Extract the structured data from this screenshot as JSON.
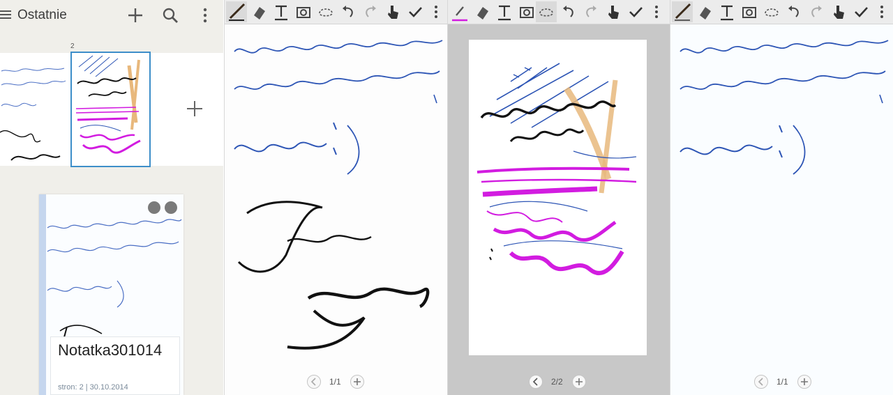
{
  "library": {
    "title": "Ostatnie",
    "thumb_page_number": "2",
    "note": {
      "name": "Notatka301014",
      "meta": "stron: 2 | 30.10.2014"
    }
  },
  "editors": [
    {
      "pager": "1/1"
    },
    {
      "pager": "2/2"
    },
    {
      "pager": "1/1"
    }
  ],
  "colors": {
    "ink_blue": "#2d55b5",
    "ink_magenta": "#d21ce0",
    "ink_black": "#111111",
    "ink_tan": "#e8b87c",
    "selection": "#3d8ec9"
  }
}
